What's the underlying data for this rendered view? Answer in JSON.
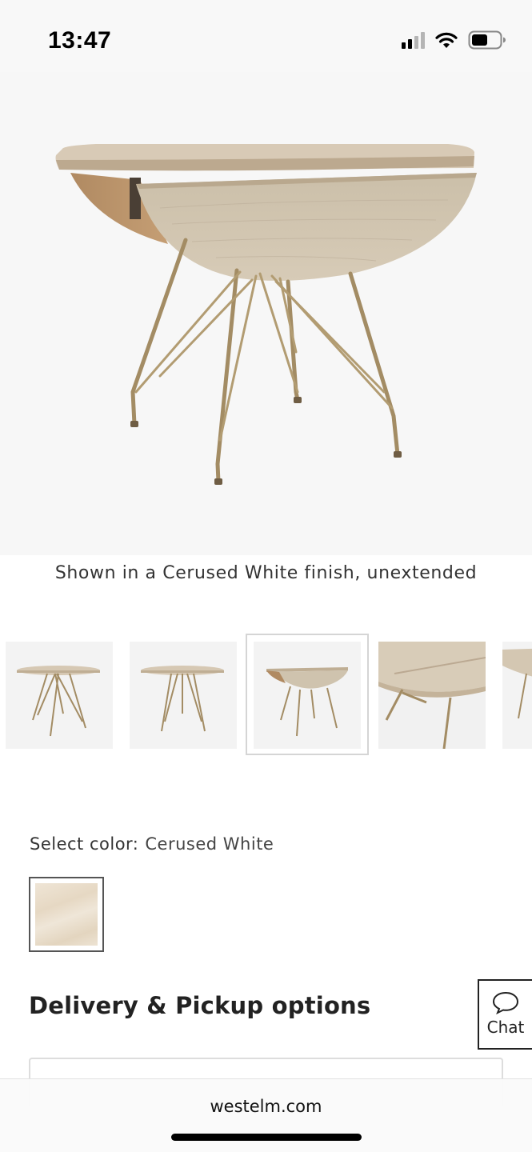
{
  "status_bar": {
    "time": "13:47",
    "icons": [
      "cellular-signal-icon",
      "wifi-icon",
      "battery-icon"
    ],
    "battery_level": 0.55
  },
  "product": {
    "hero_image": "drop-leaf-table-unextended",
    "caption": "Shown in a Cerused White finish, unextended",
    "thumbnails": [
      {
        "image": "round-table-front",
        "selected": false
      },
      {
        "image": "round-table-side",
        "selected": false
      },
      {
        "image": "drop-leaf-table-unextended",
        "selected": true
      },
      {
        "image": "tabletop-closeup",
        "selected": false
      },
      {
        "image": "table-edge-partial",
        "selected": false
      }
    ]
  },
  "color_selector": {
    "label": "Select color:",
    "selected_value": "Cerused White",
    "swatches": [
      {
        "name": "Cerused White",
        "selected": true
      }
    ]
  },
  "delivery": {
    "title": "Delivery & Pickup options"
  },
  "chat": {
    "label": "Chat",
    "icon": "speech-bubble-icon"
  },
  "browser": {
    "url": "westelm.com"
  },
  "colors": {
    "wood": "#d8cbb8",
    "metal_legs": "#a08a63",
    "text": "#222222",
    "swatch_border": "#555555"
  }
}
